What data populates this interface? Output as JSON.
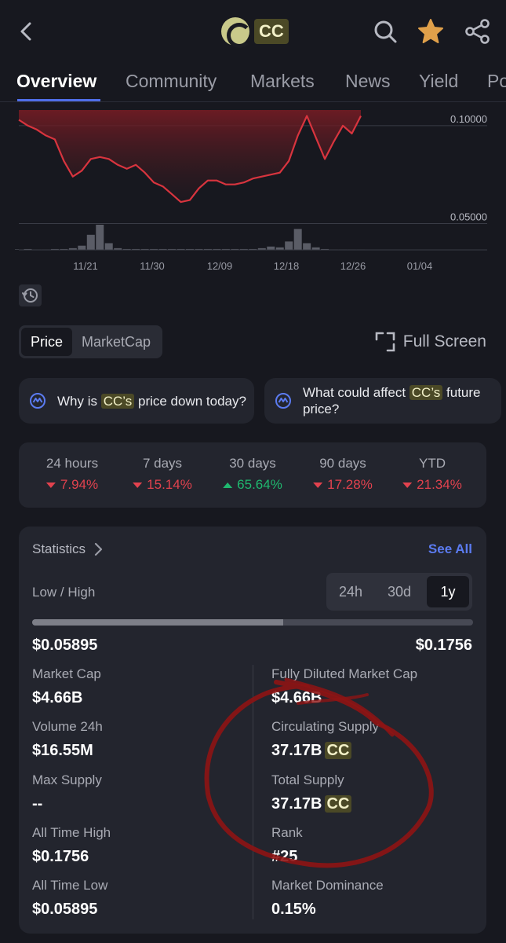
{
  "header": {
    "coin_symbol": "CC",
    "back_icon": "chevron-left-icon",
    "search_icon": "search-icon",
    "favorite_icon": "star-icon",
    "share_icon": "share-icon",
    "favorite_color": "#e0a04a"
  },
  "tabs": [
    {
      "label": "Overview",
      "active": true
    },
    {
      "label": "Community"
    },
    {
      "label": "Markets"
    },
    {
      "label": "News"
    },
    {
      "label": "Yield"
    },
    {
      "label": "Po"
    }
  ],
  "chart_data": {
    "type": "area",
    "series": [
      {
        "values": [
          0.103,
          0.1,
          0.098,
          0.095,
          0.093,
          0.082,
          0.074,
          0.077,
          0.083,
          0.084,
          0.083,
          0.08,
          0.078,
          0.08,
          0.076,
          0.071,
          0.069,
          0.065,
          0.061,
          0.062,
          0.068,
          0.072,
          0.072,
          0.07,
          0.07,
          0.071,
          0.073,
          0.074,
          0.075,
          0.076,
          0.082,
          0.095,
          0.105,
          0.094,
          0.083,
          0.092,
          0.1,
          0.096,
          0.105
        ]
      }
    ],
    "volume": [
      0.5,
      1,
      0.5,
      0.5,
      1,
      1,
      2,
      5,
      18,
      30,
      8,
      2,
      1,
      1,
      1,
      1,
      1,
      1,
      1,
      1,
      1,
      1,
      1,
      1,
      1,
      1,
      1,
      2,
      4,
      3,
      10,
      25,
      8,
      3,
      1,
      0.5,
      0.5,
      0.5,
      0.5
    ],
    "x_tick_labels": [
      "11/21",
      "11/30",
      "12/09",
      "12/18",
      "12/26",
      "01/04"
    ],
    "y_tick_labels": [
      "0.10000",
      "0.05000"
    ],
    "y_ticks": [
      0.1,
      0.05
    ],
    "ylim": [
      0.047,
      0.108
    ],
    "line_color": "#d8343e",
    "grid": true
  },
  "history_icon": "history-icon",
  "view_toggle": {
    "options": [
      "Price",
      "MarketCap"
    ],
    "selected": "Price"
  },
  "full_screen": {
    "label": "Full Screen",
    "icon": "fullscreen-icon"
  },
  "ask": [
    {
      "pre": "Why is ",
      "coin": "CC’s",
      "post": " price down today?",
      "icon": "ai-chat-icon"
    },
    {
      "pre": "What could affect ",
      "coin": "CC’s",
      "post": " future price?",
      "icon": "ai-chat-icon"
    }
  ],
  "performance": [
    {
      "label": "24 hours",
      "value": "7.94%",
      "dir": "down"
    },
    {
      "label": "7 days",
      "value": "15.14%",
      "dir": "down"
    },
    {
      "label": "30 days",
      "value": "65.64%",
      "dir": "up"
    },
    {
      "label": "90 days",
      "value": "17.28%",
      "dir": "down"
    },
    {
      "label": "YTD",
      "value": "21.34%",
      "dir": "down"
    }
  ],
  "statistics": {
    "title": "Statistics",
    "see_all": "See All",
    "low_high_label": "Low / High",
    "ranges": [
      "24h",
      "30d",
      "1y"
    ],
    "selected_range": "1y",
    "range_position": 0.57,
    "low": "$0.05895",
    "high": "$0.1756",
    "left": [
      {
        "label": "Market Cap",
        "value": "$4.66B"
      },
      {
        "label": "Volume 24h",
        "value": "$16.55M"
      },
      {
        "label": "Max Supply",
        "value": "--"
      },
      {
        "label": "All Time High",
        "value": "$0.1756"
      },
      {
        "label": "All Time Low",
        "value": "$0.05895"
      }
    ],
    "right": [
      {
        "label": "Fully Diluted Market Cap",
        "value": "$4.66B"
      },
      {
        "label": "Circulating Supply",
        "value": "37.17B",
        "unit": "CC"
      },
      {
        "label": "Total Supply",
        "value": "37.17B",
        "unit": "CC"
      },
      {
        "label": "Rank",
        "value": "#25"
      },
      {
        "label": "Market Dominance",
        "value": "0.15%"
      }
    ]
  },
  "colors": {
    "accent": "#4f6ee8",
    "up": "#1fb86f",
    "down": "#e2424e",
    "annotation": "#8e1414"
  }
}
